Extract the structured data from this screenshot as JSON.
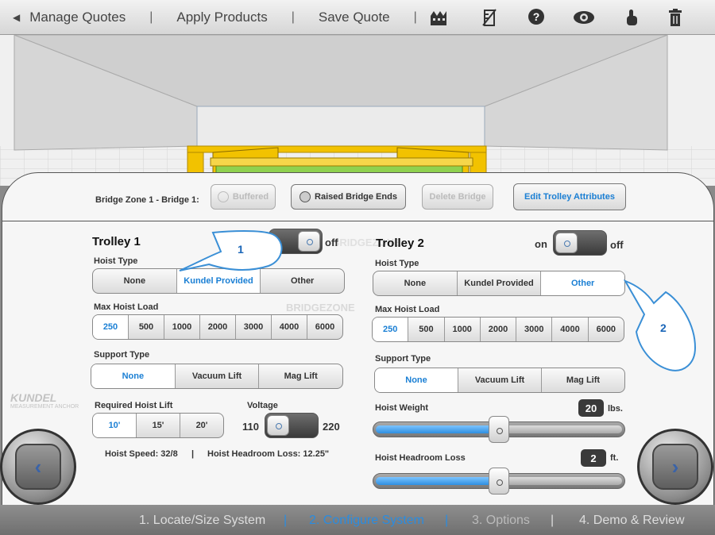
{
  "toolbar": {
    "back_label": "Manage Quotes",
    "apply_label": "Apply Products",
    "save_label": "Save Quote",
    "separator": "|"
  },
  "header": {
    "zone_label": "Bridge Zone 1 - Bridge 1:",
    "buffered_label": "Buffered",
    "raised_label": "Raised Bridge Ends",
    "delete_label": "Delete Bridge",
    "edit_label": "Edit Trolley  Attributes"
  },
  "trolley1": {
    "title": "Trolley 1",
    "off_label": "off",
    "hoist_type_label": "Hoist Type",
    "hoist_types": [
      "None",
      "Kundel Provided",
      "Other"
    ],
    "hoist_type_selected": "Kundel Provided",
    "max_load_label": "Max Hoist Load",
    "loads": [
      "250",
      "500",
      "1000",
      "2000",
      "3000",
      "4000",
      "6000"
    ],
    "load_selected": "250",
    "support_label": "Support Type",
    "supports": [
      "None",
      "Vacuum Lift",
      "Mag Lift"
    ],
    "support_selected": "None",
    "lift_label": "Required Hoist Lift",
    "lifts": [
      "10'",
      "15'",
      "20'"
    ],
    "lift_selected": "10'",
    "voltage_label": "Voltage",
    "v_low": "110",
    "v_high": "220",
    "speed_text": "Hoist Speed: 32/8",
    "info_sep": "|",
    "headroom_text": "Hoist Headroom Loss: 12.25\""
  },
  "trolley2": {
    "title": "Trolley 2",
    "on_label": "on",
    "off_label": "off",
    "hoist_type_label": "Hoist Type",
    "hoist_types": [
      "None",
      "Kundel Provided",
      "Other"
    ],
    "hoist_type_selected": "Other",
    "max_load_label": "Max Hoist Load",
    "loads": [
      "250",
      "500",
      "1000",
      "2000",
      "3000",
      "4000",
      "6000"
    ],
    "load_selected": "250",
    "support_label": "Support Type",
    "supports": [
      "None",
      "Vacuum Lift",
      "Mag Lift"
    ],
    "support_selected": "None",
    "weight_label": "Hoist Weight",
    "weight_value": "20",
    "weight_unit": "lbs.",
    "weight_fraction": 0.5,
    "headroom_label": "Hoist Headroom Loss",
    "headroom_value": "2",
    "headroom_unit": "ft.",
    "headroom_fraction": 0.5
  },
  "callouts": {
    "one": "1",
    "two": "2"
  },
  "watermark": {
    "zone": "BRIDGEZONE",
    "brand": "KUNDEL",
    "brand_sub": "MEASUREMENT ANCHOR"
  },
  "footer": {
    "steps": [
      "1. Locate/Size System",
      "2. Configure System",
      "3. Options",
      "4. Demo & Review"
    ],
    "active_step": 1,
    "separator": "|"
  },
  "colors": {
    "accent": "#1a7fd4",
    "active_step": "#2a8ce0"
  }
}
